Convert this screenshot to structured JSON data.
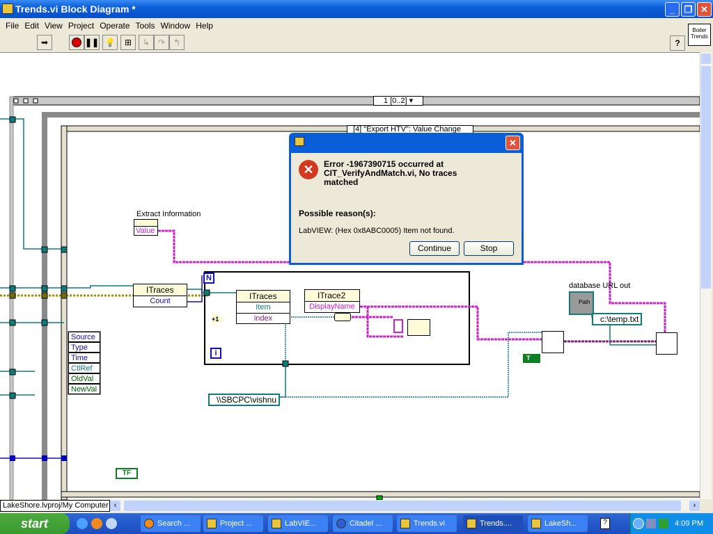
{
  "window": {
    "title": "Trends.vi Block Diagram *",
    "minimize": "_",
    "restore": "❐",
    "close": "✕"
  },
  "menu": [
    "File",
    "Edit",
    "View",
    "Project",
    "Operate",
    "Tools",
    "Window",
    "Help"
  ],
  "toolbar": {
    "icons": [
      "run-arrow",
      "abort",
      "pause",
      "highlight-execution",
      "retain-wire-values",
      "step-into",
      "step-over",
      "step-out"
    ],
    "help": "?",
    "vi_icon_label": "Boiler Trends"
  },
  "diagram": {
    "sequence_selector": "1 [0..2]",
    "case_selector": "[4] \"Export HTV\": Value Change",
    "extract_label": "Extract Information",
    "extract_value": "Value",
    "itraces_node": {
      "title": "ITraces",
      "prop": "Count"
    },
    "loop_count": "N",
    "loop_index": "i",
    "increment": "+1",
    "itraces_method": {
      "title": "ITraces",
      "rows": [
        "Item",
        "index"
      ]
    },
    "itrace2_node": {
      "title": "ITrace2",
      "prop": "DisplayName"
    },
    "event_data": [
      "Source",
      "Type",
      "Time",
      "CtlRef",
      "OldVal",
      "NewVal"
    ],
    "path_label": "database URL out",
    "path_indicator": "Path",
    "temp_path": "c:\\temp.txt",
    "computer_path": "\\\\SBCPC\\vishnu",
    "bool_const_small": "T",
    "bool_const": "TF"
  },
  "dialog": {
    "error_title": "Error -1967390715 occurred at CIT_VerifyAndMatch.vi,  No traces matched",
    "reason_header": "Possible reason(s):",
    "reason": "LabVIEW:  (Hex 0x8ABC0005) Item not found.",
    "continue": "Continue",
    "stop": "Stop",
    "close": "✕"
  },
  "status": "LakeShore.lvproj/My Computer",
  "taskbar": {
    "start": "start",
    "tasks": [
      "Search ...",
      "Project ...",
      "LabVIE...",
      "Citadel ...",
      "Trends.vi",
      "Trends....",
      "LakeSh..."
    ],
    "time": "4:09 PM"
  }
}
